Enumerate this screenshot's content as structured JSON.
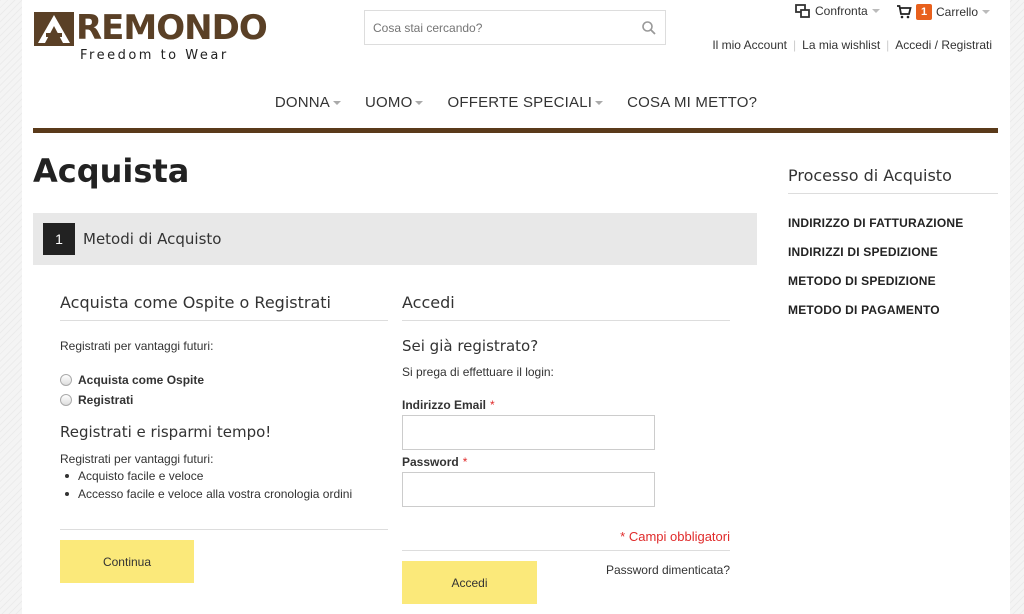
{
  "brand": {
    "logo_text": "REMONDO",
    "logo_letter": "A",
    "tagline": "Freedom to Wear"
  },
  "search": {
    "placeholder": "Cosa stai cercando?",
    "icon": "search-icon"
  },
  "header": {
    "compare_label": "Confronta",
    "cart_label": "Carrello",
    "cart_count": "1",
    "account_links": [
      "Il mio Account",
      "La mia wishlist",
      "Accedi / Registrati"
    ]
  },
  "nav": [
    "DONNA",
    "UOMO",
    "OFFERTE SPECIALI",
    "COSA MI METTO?"
  ],
  "page": {
    "title": "Acquista"
  },
  "step": {
    "number": "1",
    "label": "Metodi di Acquisto"
  },
  "guest": {
    "title": "Acquista come Ospite o Registrati",
    "intro": "Registrati per vantaggi futuri:",
    "options": [
      "Acquista come Ospite",
      "Registrati"
    ],
    "subtitle": "Registrati e risparmi tempo!",
    "benefits_intro": "Registrati per vantaggi futuri:",
    "benefits": [
      "Acquisto facile e veloce",
      "Accesso facile e veloce alla vostra cronologia ordini"
    ],
    "continue_label": "Continua"
  },
  "login": {
    "title": "Accedi",
    "question": "Sei già registrato?",
    "prompt": "Si prega di effettuare il login:",
    "email_label": "Indirizzo Email",
    "password_label": "Password",
    "required_mark": "*",
    "required_note": "* Campi obbligatori",
    "forgot_label": "Password dimenticata?",
    "submit_label": "Accedi"
  },
  "sidebar": {
    "title": "Processo di Acquisto",
    "steps": [
      "INDIRIZZO DI FATTURAZIONE",
      "INDIRIZZI DI SPEDIZIONE",
      "METODO DI SPEDIZIONE",
      "METODO DI PAGAMENTO"
    ]
  },
  "colors": {
    "brand_brown": "#5a3a1a",
    "button_yellow": "#fbe97a",
    "cart_badge": "#e8601c",
    "required_red": "#e02b2b"
  }
}
